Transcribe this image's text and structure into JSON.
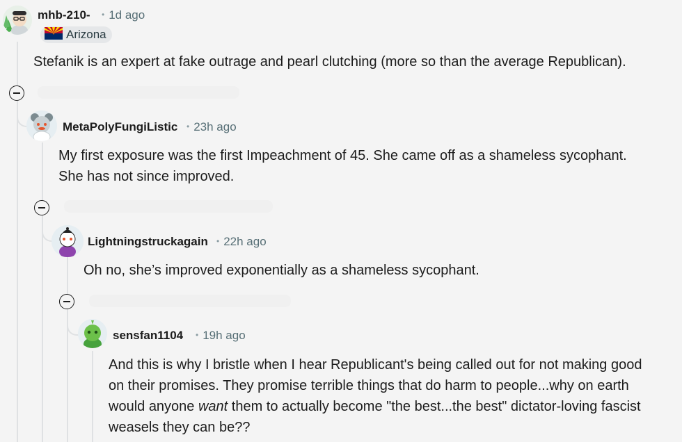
{
  "comments": [
    {
      "username": "mhb-210-",
      "time": "1d ago",
      "flair": "Arizona",
      "body": "Stefanik is an expert at fake outrage and pearl clutching (more so than the average Republican)."
    },
    {
      "username": "MetaPolyFungiListic",
      "time": "23h ago",
      "body_lines": [
        "My first exposure was the first Impeachment of 45. She came off as a shameless sycophant.",
        "She has not since improved."
      ]
    },
    {
      "username": "Lightningstruckagain",
      "time": "22h ago",
      "body": "Oh no, she’s improved exponentially as a shameless sycophant."
    },
    {
      "username": "sensfan1104",
      "time": "19h ago",
      "body_lines": [
        "And this is why I bristle when I hear Republicant's being called out for not making good",
        "on their promises. They promise terrible things that do harm to people...why on earth",
        "would anyone ",
        "want",
        " them to actually become \"the best...the best\" dictator-loving fascist",
        "weasels they can be??"
      ]
    }
  ],
  "icons": {
    "collapse": "minus-circle-icon",
    "flag": "arizona-flag-icon"
  },
  "colors": {
    "background": "#f4f4f4",
    "thread_line": "#dfe1e3",
    "meta_text": "#576f76",
    "flair_bg": "#e5e7e9"
  }
}
